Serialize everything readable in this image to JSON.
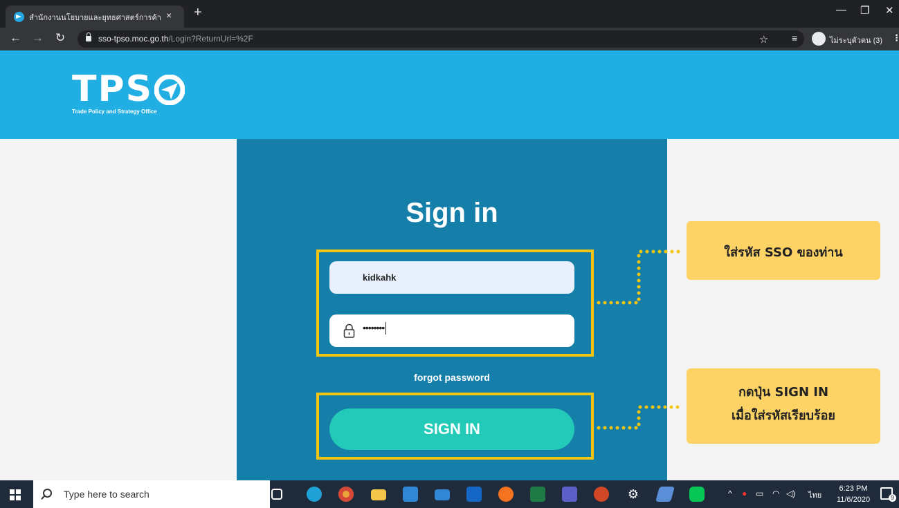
{
  "browser": {
    "tab_title": "สำนักงานนโยบายและยุทธศาสตร์การค้า",
    "tab_close": "×",
    "new_tab": "+",
    "url_host": "sso-tpso.moc.go.th",
    "url_path": "/Login?ReturnUrl=%2F",
    "profile_label": "ไม่ระบุตัวตน (3)",
    "window_minimize": "—",
    "window_restore": "❐",
    "window_close": "✕"
  },
  "header": {
    "logo_text": "TPS",
    "logo_subtitle": "Trade Policy and Strategy Office",
    "background_color": "#21aee3"
  },
  "login": {
    "title": "Sign in",
    "username_value": "kidkahk",
    "password_value": "••••••••",
    "forgot_label": "forgot password",
    "submit_label": "SIGN IN",
    "panel_color": "#157faa",
    "button_color": "#23cab8"
  },
  "annotations": {
    "callout_1": "ใส่รหัส SSO ของท่าน",
    "callout_2_line_1": "กดปุ่น SIGN IN",
    "callout_2_line_2": "เมื่อใส่รหัสเรียบร้อย",
    "highlight_color": "#f2c512",
    "callout_color": "#fed366"
  },
  "taskbar": {
    "search_placeholder": "Type here to search",
    "tray_language": "ไทย",
    "time": "6:23 PM",
    "date": "11/6/2020",
    "notification_count": "9",
    "apps": [
      "task-view",
      "edge",
      "chrome",
      "file-explorer",
      "store",
      "mail",
      "outlook",
      "app-orange",
      "excel",
      "teams",
      "powerpoint",
      "settings",
      "app-blue",
      "line"
    ]
  }
}
